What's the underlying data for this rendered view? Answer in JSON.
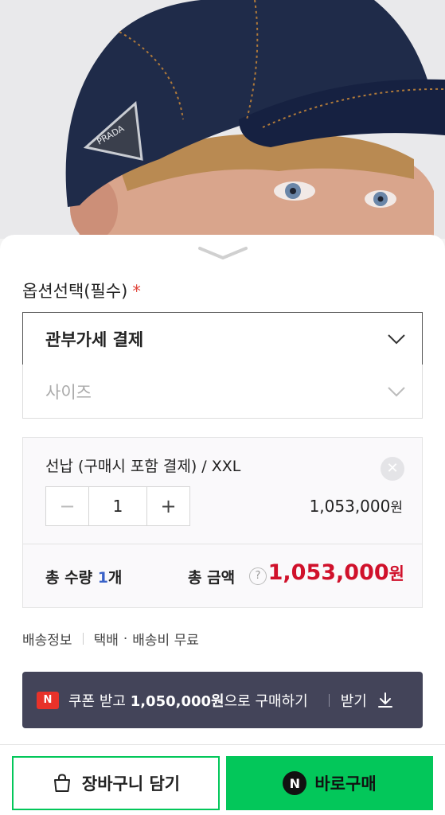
{
  "product_image": {
    "alt_icon": "product-photo",
    "logo_text": "PRADA"
  },
  "options": {
    "title": "옵션선택(필수)",
    "required_mark": "*",
    "select1_value": "관부가세 결제",
    "select2_placeholder": "사이즈"
  },
  "selected_item": {
    "name": "선납 (구매시 포함 결제) / XXL",
    "remove_icon": "close-icon",
    "quantity": "1",
    "minus_label": "−",
    "plus_label": "+",
    "price": "1,053,000",
    "price_unit": "원"
  },
  "totals": {
    "qty_label": "총 수량",
    "qty_value": "1",
    "qty_unit": "개",
    "amount_label": "총 금액",
    "help_icon": "?",
    "amount_value": "1,053,000",
    "amount_unit": "원"
  },
  "shipping": {
    "label": "배송정보",
    "method": "택배",
    "dot": "·",
    "fee": "배송비 무료"
  },
  "coupon": {
    "icon_text": "N",
    "text_pre": "쿠폰 받고 ",
    "text_bold": "1,050,000원",
    "text_post": "으로 구매하기",
    "action": "받기"
  },
  "actions": {
    "cart_label": "장바구니 담기",
    "buy_badge": "N",
    "buy_label": "바로구매"
  },
  "colors": {
    "accent_green": "#03c75a",
    "price_red": "#d0112b",
    "coupon_bg": "#434459",
    "qty_blue": "#3a62c8"
  }
}
